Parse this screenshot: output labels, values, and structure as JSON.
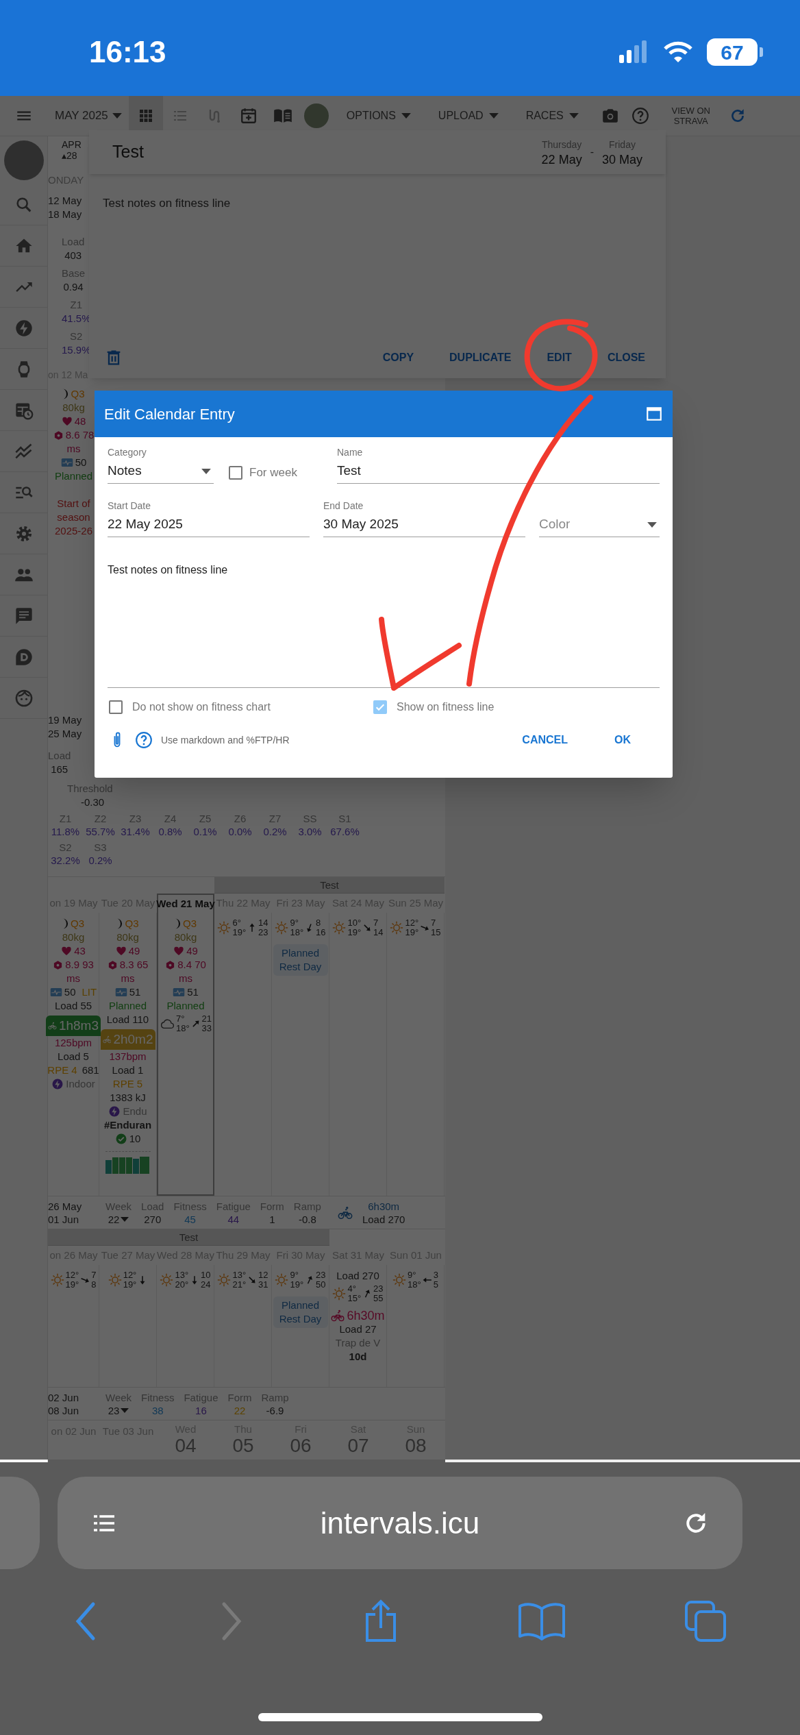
{
  "status_bar": {
    "time": "16:13",
    "battery": "67"
  },
  "toolbar": {
    "month": "MAY 2025",
    "views": [
      {
        "selected": true
      },
      {
        "selected": false
      },
      {
        "selected": false
      }
    ],
    "menus": [
      "OPTIONS",
      "UPLOAD",
      "RACES"
    ],
    "strava": "VIEW ON STRAVA"
  },
  "week_12_may": {
    "month": "APR",
    "marker": "▴28",
    "weekday": "ONDAY",
    "range": [
      "12 May",
      "18 May"
    ],
    "stats": [
      {
        "kind": "plain",
        "label": "Load",
        "value": "403"
      },
      {
        "kind": "plain",
        "label": "Base",
        "value": "0.94"
      },
      {
        "kind": "zone",
        "label": "Z1",
        "value": "41.5%"
      },
      {
        "kind": "zone",
        "label": "S2",
        "value": "15.9%"
      }
    ],
    "day_header": "on 12 Ma",
    "day_lines": [
      {
        "kind": "moon",
        "text": "Q3"
      },
      {
        "kind": "weight",
        "text": "80kg"
      },
      {
        "kind": "heart",
        "text": "48"
      },
      {
        "kind": "hrv",
        "text": "8.6 78"
      },
      {
        "kind": "unit",
        "text": "ms"
      },
      {
        "kind": "form",
        "text": "50"
      },
      {
        "kind": "status",
        "text": "Planned"
      },
      {
        "kind": "season_note",
        "text": "Start of season 2025-26"
      }
    ]
  },
  "week_19_may": {
    "range": [
      "19 May",
      "25 May"
    ],
    "stats": [
      {
        "label": "Load",
        "value": "165"
      }
    ],
    "threshold": {
      "label": "Threshold",
      "value": "-0.30"
    },
    "zones": [
      {
        "label": "Z1",
        "value": "11.8%"
      },
      {
        "label": "Z2",
        "value": "55.7%"
      },
      {
        "label": "Z3",
        "value": "31.4%"
      },
      {
        "label": "Z4",
        "value": "0.8%"
      },
      {
        "label": "Z5",
        "value": "0.1%"
      },
      {
        "label": "Z6",
        "value": "0.0%"
      },
      {
        "label": "Z7",
        "value": "0.2%"
      },
      {
        "label": "SS",
        "value": "3.0%"
      },
      {
        "label": "S1",
        "value": "67.6%"
      }
    ],
    "zones_2": [
      {
        "label": "S2",
        "value": "32.2%"
      },
      {
        "label": "S3",
        "value": "0.2%"
      }
    ],
    "band": "Test",
    "days": [
      {
        "header": "on 19 May",
        "today": false,
        "in_band": false,
        "lines": [
          {
            "kind": "moon",
            "text": "Q3"
          },
          {
            "kind": "weight",
            "text": "80kg"
          },
          {
            "kind": "heart",
            "text": "43"
          },
          {
            "kind": "hrv",
            "text": "8.9 93"
          },
          {
            "kind": "unit",
            "text": "ms"
          },
          {
            "kind": "form",
            "text": "50",
            "tag": "LIT"
          },
          {
            "kind": "load",
            "text": "Load 55"
          },
          {
            "kind": "workout_green",
            "text": "1h8m3"
          },
          {
            "kind": "bpm",
            "text": "125bpm"
          },
          {
            "kind": "load",
            "text": "Load 5"
          },
          {
            "kind": "rpe",
            "rpe": "RPE 4",
            "text": "681"
          },
          {
            "kind": "power",
            "text": "Indoor"
          }
        ]
      },
      {
        "header": "Tue 20 May",
        "today": false,
        "in_band": false,
        "lines": [
          {
            "kind": "moon",
            "text": "Q3"
          },
          {
            "kind": "weight",
            "text": "80kg"
          },
          {
            "kind": "heart",
            "text": "49"
          },
          {
            "kind": "hrv",
            "text": "8.3 65"
          },
          {
            "kind": "unit",
            "text": "ms"
          },
          {
            "kind": "form",
            "text": "51"
          },
          {
            "kind": "status",
            "text": "Planned"
          },
          {
            "kind": "load",
            "text": "Load 110"
          },
          {
            "kind": "workout_yellow",
            "text": "2h0m2"
          },
          {
            "kind": "bpm",
            "text": "137bpm"
          },
          {
            "kind": "load",
            "text": "Load 1"
          },
          {
            "kind": "rpe",
            "rpe": "RPE 5"
          },
          {
            "kind": "plain",
            "text": "1383 kJ"
          },
          {
            "kind": "power",
            "text": "Endu"
          },
          {
            "kind": "tag",
            "text": "#Enduran"
          },
          {
            "kind": "done",
            "text": "10"
          },
          {
            "kind": "power_chart"
          }
        ]
      },
      {
        "header": "Wed 21 May",
        "today": true,
        "in_band": false,
        "lines": [
          {
            "kind": "moon",
            "text": "Q3"
          },
          {
            "kind": "weight",
            "text": "80kg"
          },
          {
            "kind": "heart",
            "text": "49"
          },
          {
            "kind": "hrv",
            "text": "8.4 70"
          },
          {
            "kind": "unit",
            "text": "ms"
          },
          {
            "kind": "form",
            "text": "51"
          },
          {
            "kind": "status",
            "text": "Planned"
          },
          {
            "kind": "weather_cloud",
            "low": "7°",
            "high": "18°",
            "arrow": {
              "kind": "NE"
            },
            "wind": [
              "21",
              "33"
            ]
          }
        ]
      },
      {
        "header": "Thu 22 May",
        "today": false,
        "in_band": true,
        "lines": [
          {
            "kind": "weather_sun",
            "low": "6°",
            "high": "19°",
            "arrow": {
              "kind": "N"
            },
            "wind": [
              "14",
              "23"
            ]
          }
        ]
      },
      {
        "header": "Fri 23 May",
        "today": false,
        "in_band": true,
        "lines": [
          {
            "kind": "weather_sun",
            "low": "9°",
            "high": "18°",
            "arrow": {
              "kind": "SSW"
            },
            "wind": [
              "8",
              "16"
            ]
          },
          {
            "kind": "rest",
            "text": "Planned Rest Day"
          }
        ]
      },
      {
        "header": "Sat 24 May",
        "today": false,
        "in_band": true,
        "lines": [
          {
            "kind": "weather_sun",
            "low": "10°",
            "high": "19°",
            "arrow": {
              "kind": "SE"
            },
            "wind": [
              "7",
              "14"
            ]
          }
        ]
      },
      {
        "header": "Sun 25 May",
        "today": false,
        "in_band": true,
        "lines": [
          {
            "kind": "weather_sun",
            "low": "12°",
            "high": "19°",
            "arrow": {
              "kind": "ESE"
            },
            "wind": [
              "7",
              "15"
            ]
          }
        ]
      }
    ]
  },
  "summary_26_may": {
    "range": [
      "26 May",
      "01 Jun"
    ],
    "week": {
      "label": "Week",
      "value": "22"
    },
    "stats": [
      {
        "kind": "plain",
        "label": "Load",
        "value": "270"
      },
      {
        "kind": "fitness",
        "label": "Fitness",
        "value": "45"
      },
      {
        "kind": "fatigue",
        "label": "Fatigue",
        "value": "44"
      },
      {
        "kind": "plain",
        "label": "Form",
        "value": "1"
      },
      {
        "kind": "plain",
        "label": "Ramp",
        "value": "-0.8"
      }
    ],
    "total": {
      "time": "6h30m",
      "load": "Load 270"
    }
  },
  "week_26_may": {
    "band": "Test",
    "days": [
      {
        "header": "on 26 May",
        "today": false,
        "in_band": true,
        "lines": [
          {
            "kind": "weather_sun",
            "low": "12°",
            "high": "19°",
            "arrow": {
              "kind": "ESE"
            },
            "wind": [
              "7",
              "8"
            ]
          }
        ]
      },
      {
        "header": "Tue 27 May",
        "today": false,
        "in_band": true,
        "lines": [
          {
            "kind": "weather_sun",
            "low": "12°",
            "high": "19°",
            "arrow": {
              "kind": "S"
            }
          }
        ]
      },
      {
        "header": "Wed 28 May",
        "today": false,
        "in_band": true,
        "lines": [
          {
            "kind": "weather_sun",
            "low": "13°",
            "high": "20°",
            "arrow": {
              "kind": "S"
            },
            "wind": [
              "10",
              "24"
            ]
          }
        ]
      },
      {
        "header": "Thu 29 May",
        "today": false,
        "in_band": true,
        "lines": [
          {
            "kind": "weather_sun",
            "low": "13°",
            "high": "21°",
            "arrow": {
              "kind": "SE"
            },
            "wind": [
              "12",
              "31"
            ]
          }
        ]
      },
      {
        "header": "Fri 30 May",
        "today": false,
        "in_band": true,
        "lines": [
          {
            "kind": "weather_sun",
            "low": "9°",
            "high": "19°",
            "arrow": {
              "kind": "NNE"
            },
            "wind": [
              "23",
              "50"
            ]
          },
          {
            "kind": "rest",
            "text": "Planned Rest Day"
          }
        ]
      },
      {
        "header": "Sat 31 May",
        "today": false,
        "in_band": false,
        "lines": [
          {
            "kind": "load",
            "text": "Load 270"
          },
          {
            "kind": "weather_sun",
            "low": "4°",
            "high": "15°",
            "arrow": {
              "kind": "NNE"
            },
            "wind": [
              "23",
              "55"
            ]
          },
          {
            "kind": "workout_outline",
            "text": "6h30m"
          },
          {
            "kind": "load",
            "text": "Load 27"
          },
          {
            "kind": "detail",
            "text": "Trap de V"
          },
          {
            "kind": "tag",
            "text": "10d"
          }
        ]
      },
      {
        "header": "Sun 01 Jun",
        "today": false,
        "in_band": false,
        "lines": [
          {
            "kind": "weather_sun",
            "low": "9°",
            "high": "18°",
            "arrow": {
              "kind": "W"
            },
            "wind": [
              "3",
              "5"
            ]
          }
        ]
      }
    ]
  },
  "summary_02_jun": {
    "range": [
      "02 Jun",
      "08 Jun"
    ],
    "week": {
      "label": "Week",
      "value": "23"
    },
    "stats": [
      {
        "kind": "fitness",
        "label": "Fitness",
        "value": "38"
      },
      {
        "kind": "fatigue",
        "label": "Fatigue",
        "value": "16"
      },
      {
        "kind": "form_good",
        "label": "Form",
        "value": "22"
      },
      {
        "kind": "plain",
        "label": "Ramp",
        "value": "-6.9"
      }
    ]
  },
  "week_02_jun": {
    "headers": [
      {
        "kind": "label",
        "text": "on 02 Jun"
      },
      {
        "kind": "label",
        "text": "Tue 03 Jun"
      },
      {
        "kind": "big",
        "weekday": "Wed",
        "day": "04"
      },
      {
        "kind": "big",
        "weekday": "Thu",
        "day": "05"
      },
      {
        "kind": "big",
        "weekday": "Fri",
        "day": "06"
      },
      {
        "kind": "big",
        "weekday": "Sat",
        "day": "07"
      },
      {
        "kind": "big",
        "weekday": "Sun",
        "day": "08"
      }
    ]
  },
  "entry_dialog": {
    "title": "Test",
    "start": {
      "weekday": "Thursday",
      "date": "22 May"
    },
    "separator": "-",
    "end": {
      "weekday": "Friday",
      "date": "30 May"
    },
    "notes": "Test notes on fitness line",
    "buttons": [
      "COPY",
      "DUPLICATE",
      "EDIT",
      "CLOSE"
    ]
  },
  "edit_dialog": {
    "title": "Edit Calendar Entry",
    "row_1": [
      {
        "kind": "select",
        "label": "Category",
        "value": "Notes"
      },
      {
        "kind": "checkbox",
        "label": "For week",
        "checked": false
      },
      {
        "kind": "text",
        "label": "Name",
        "value": "Test"
      }
    ],
    "row_2": [
      {
        "kind": "text",
        "label": "Start Date",
        "value": "22 May 2025"
      },
      {
        "kind": "text",
        "label": "End Date",
        "value": "30 May 2025"
      },
      {
        "kind": "select",
        "placeholder": "Color"
      }
    ],
    "notes": "Test notes on fitness line",
    "options": [
      {
        "label": "Do not show on fitness chart",
        "checked": false
      },
      {
        "label": "Show on fitness line",
        "checked": true
      }
    ],
    "hint": "Use markdown and %FTP/HR",
    "buttons": [
      "CANCEL",
      "OK"
    ]
  },
  "browser": {
    "url": "intervals.icu"
  }
}
